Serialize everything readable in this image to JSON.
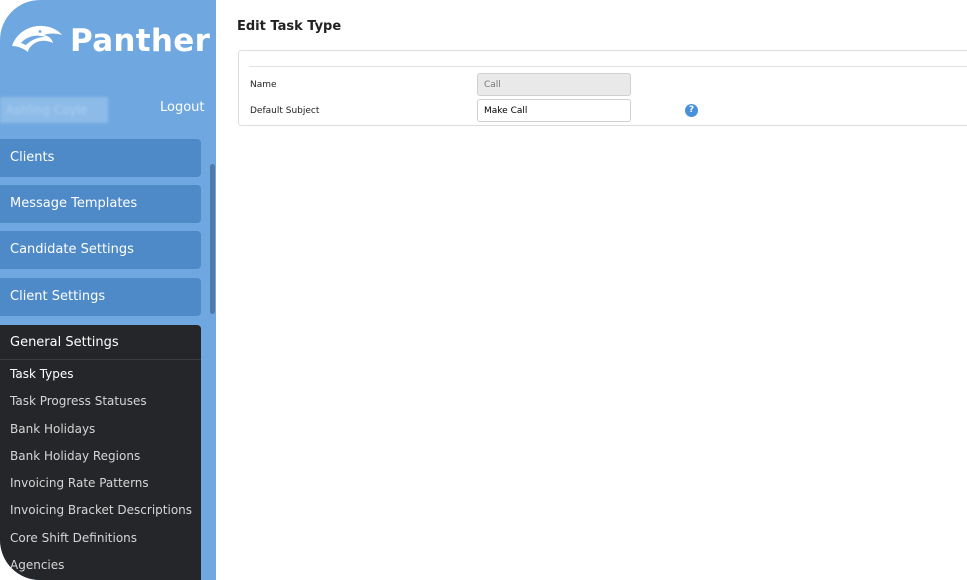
{
  "app": {
    "logo_text": "Panther"
  },
  "header": {
    "user_name": "Ashling Coyle",
    "logout_label": "Logout"
  },
  "sidebar": {
    "nav_buttons": [
      {
        "label": "Clients"
      },
      {
        "label": "Message Templates"
      },
      {
        "label": "Candidate Settings"
      },
      {
        "label": "Client Settings"
      }
    ],
    "menu": {
      "header": "General Settings",
      "active_item": "Task Types",
      "items": [
        {
          "label": "Task Types"
        },
        {
          "label": "Task Progress Statuses"
        },
        {
          "label": "Bank Holidays"
        },
        {
          "label": "Bank Holiday Regions"
        },
        {
          "label": "Invoicing Rate Patterns"
        },
        {
          "label": "Invoicing Bracket Descriptions"
        },
        {
          "label": "Core Shift Definitions"
        },
        {
          "label": "Agencies"
        }
      ]
    }
  },
  "main": {
    "title": "Edit Task Type",
    "form": {
      "name_label": "Name",
      "name_value": "Call",
      "default_subject_label": "Default Subject",
      "default_subject_value": "Make Call",
      "help_icon": "question-circle-icon"
    }
  },
  "colors": {
    "sidebar_bg": "#6fa8e0",
    "nav_button_bg": "#4f8ac8",
    "menu_bg": "#252629",
    "help_icon": "#4a90d9"
  }
}
